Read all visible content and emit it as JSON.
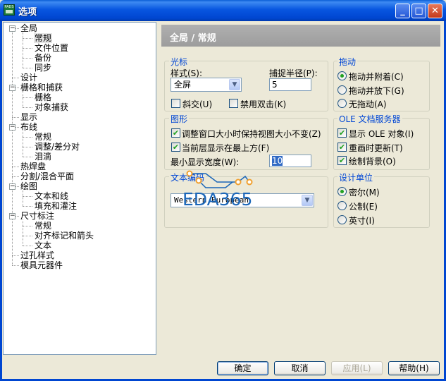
{
  "window": {
    "title": "选项",
    "app_icon": "pads-logo-icon"
  },
  "titlebar_buttons": {
    "minimize": "_",
    "maximize": "□",
    "close": "✕"
  },
  "tree": {
    "items": [
      {
        "label": "全局",
        "level": 0,
        "expand": "−"
      },
      {
        "label": "常规",
        "level": 1,
        "selected": true
      },
      {
        "label": "文件位置",
        "level": 1
      },
      {
        "label": "备份",
        "level": 1
      },
      {
        "label": "同步",
        "level": 1
      },
      {
        "label": "设计",
        "level": 0
      },
      {
        "label": "栅格和捕获",
        "level": 0,
        "expand": "−"
      },
      {
        "label": "栅格",
        "level": 1
      },
      {
        "label": "对象捕获",
        "level": 1
      },
      {
        "label": "显示",
        "level": 0
      },
      {
        "label": "布线",
        "level": 0,
        "expand": "−"
      },
      {
        "label": "常规",
        "level": 1
      },
      {
        "label": "调整/差分对",
        "level": 1
      },
      {
        "label": "泪滴",
        "level": 1
      },
      {
        "label": "热焊盘",
        "level": 0
      },
      {
        "label": "分割/混合平面",
        "level": 0
      },
      {
        "label": "绘图",
        "level": 0,
        "expand": "−"
      },
      {
        "label": "文本和线",
        "level": 1
      },
      {
        "label": "填充和灌注",
        "level": 1
      },
      {
        "label": "尺寸标注",
        "level": 0,
        "expand": "−"
      },
      {
        "label": "常规",
        "level": 1
      },
      {
        "label": "对齐标记和箭头",
        "level": 1
      },
      {
        "label": "文本",
        "level": 1
      },
      {
        "label": "过孔样式",
        "level": 0
      },
      {
        "label": "模具元器件",
        "level": 0
      }
    ]
  },
  "header": {
    "title": "全局 / 常规"
  },
  "cursor_group": {
    "title": "光标",
    "style_label": "样式(S):",
    "style_value": "全屏",
    "snap_radius_label": "捕捉半径(P):",
    "snap_radius_value": "5",
    "orthogonal_label": "斜交(U)",
    "orthogonal_checked": false,
    "disable_double_click_label": "禁用双击(K)",
    "disable_double_click_checked": false
  },
  "drag_group": {
    "title": "拖动",
    "options": [
      {
        "label": "拖动并附着(C)",
        "selected": true
      },
      {
        "label": "拖动并放下(G)",
        "selected": false
      },
      {
        "label": "无拖动(A)",
        "selected": false
      }
    ]
  },
  "graphics_group": {
    "title": "图形",
    "keep_view_label": "调整窗口大小时保持视图大小不变(Z)",
    "keep_view_checked": true,
    "active_layer_top_label": "当前层显示在最上方(F)",
    "active_layer_top_checked": true,
    "min_width_label": "最小显示宽度(W):",
    "min_width_value": "10"
  },
  "ole_group": {
    "title": "OLE 文档服务器",
    "options": [
      {
        "label": "显示 OLE 对象(I)",
        "checked": true
      },
      {
        "label": "重画时更新(T)",
        "checked": true
      },
      {
        "label": "绘制背景(O)",
        "checked": true
      }
    ]
  },
  "text_encoding_group": {
    "title": "文本编码",
    "value": "Western European"
  },
  "units_group": {
    "title": "设计单位",
    "options": [
      {
        "label": "密尔(M)",
        "selected": true
      },
      {
        "label": "公制(E)",
        "selected": false
      },
      {
        "label": "英寸(I)",
        "selected": false
      }
    ]
  },
  "watermark": {
    "text": "EDA365"
  },
  "buttons": {
    "ok": "确定",
    "cancel": "取消",
    "apply": "应用(L)",
    "help": "帮助(H)"
  },
  "colors": {
    "title_bar": "#0046d1",
    "group_title": "#0046d5",
    "check_mark": "#21a121",
    "watermark": "#1b66b8"
  }
}
